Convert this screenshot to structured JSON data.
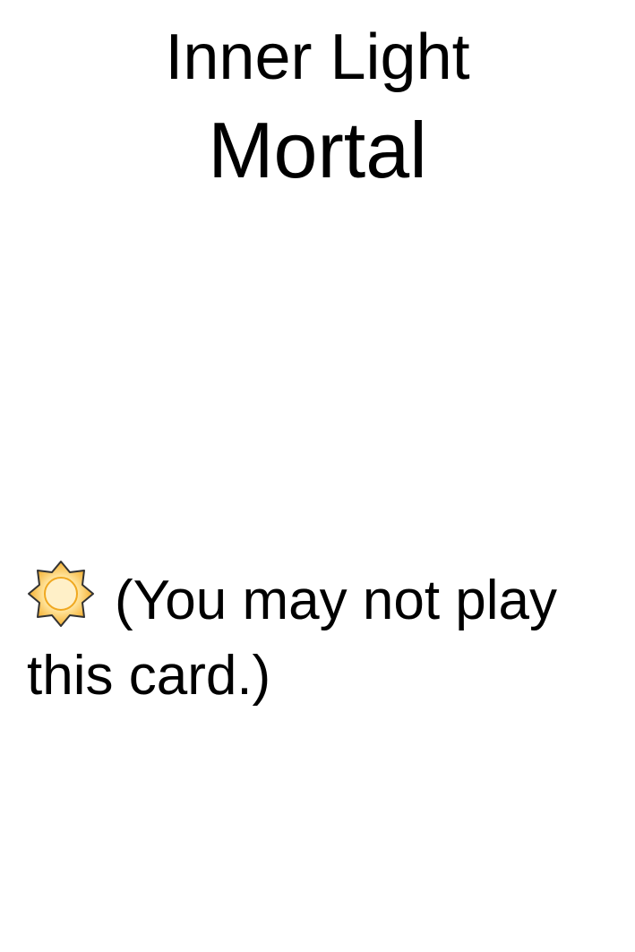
{
  "card": {
    "name": "Inner Light",
    "type": "Mortal",
    "rules_icon": "sun-icon",
    "rules_text": "(You may not play this card.)",
    "colors": {
      "icon_fill_outer": "#f5b030",
      "icon_fill_inner": "#fff0c0",
      "icon_stroke": "#333333"
    }
  }
}
